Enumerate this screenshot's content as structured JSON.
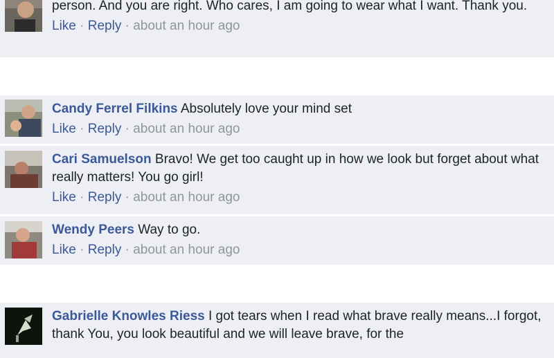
{
  "actions": {
    "like": "Like",
    "reply": "Reply",
    "sep": "·"
  },
  "comments": [
    {
      "author": "",
      "text": "person. And you are right. Who cares, I am going to wear what I want. Thank you.",
      "time": "about an hour ago"
    },
    {
      "author": "Candy Ferrel Filkins",
      "text": "Absolutely love your mind set",
      "time": "about an hour ago"
    },
    {
      "author": "Cari Samuelson",
      "text": "Bravo! We get too caught up in how we look but forget about what really matters! You go girl!",
      "time": "about an hour ago"
    },
    {
      "author": "Wendy Peers",
      "text": "Way to go.",
      "time": "about an hour ago"
    },
    {
      "author": "Gabrielle Knowles Riess",
      "text": "I got tears when I read what brave really means...I forgot, thank You, you look beautiful and we will leave brave, for the",
      "time": ""
    }
  ]
}
